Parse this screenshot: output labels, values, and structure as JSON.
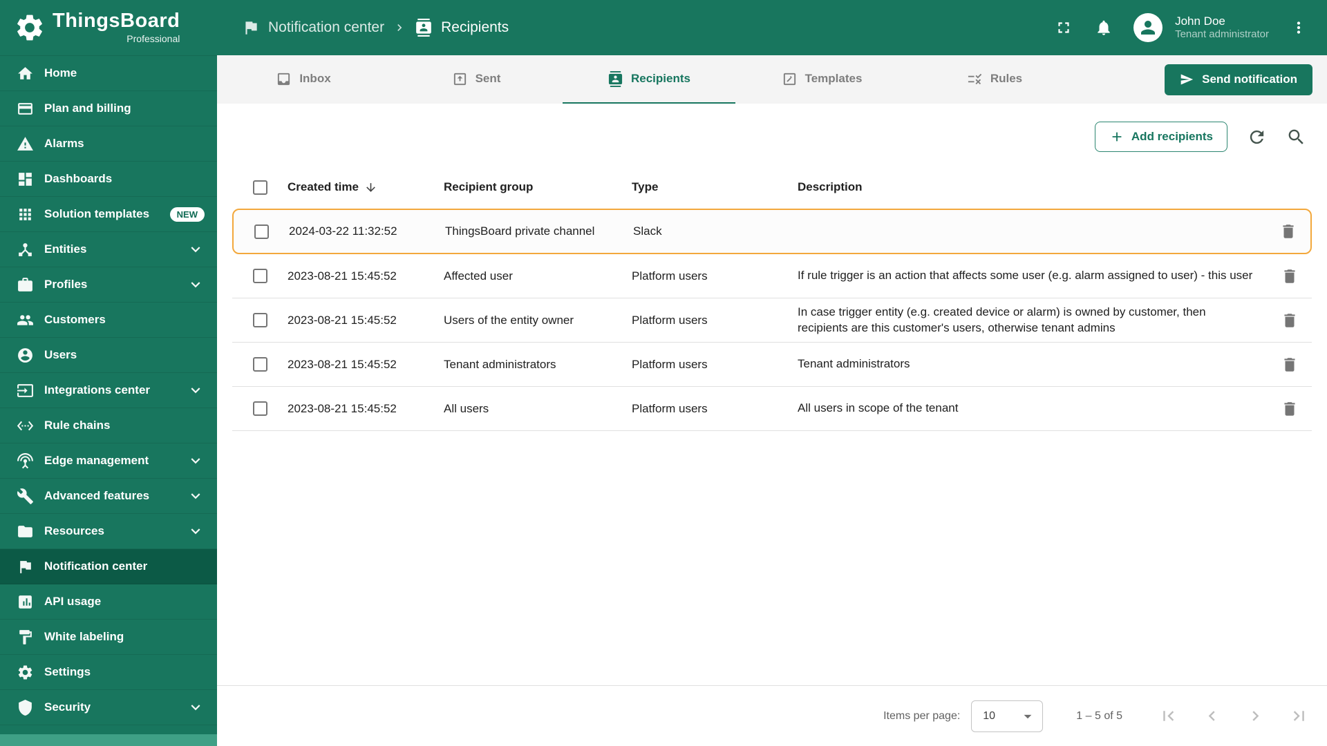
{
  "brand": {
    "name": "ThingsBoard",
    "edition": "Professional"
  },
  "breadcrumb": {
    "parent": "Notification center",
    "current": "Recipients"
  },
  "user": {
    "name": "John Doe",
    "role": "Tenant administrator"
  },
  "colors": {
    "primary": "#18765E",
    "sidebar_active": "#0C5A46",
    "highlight_border": "#F3A83C"
  },
  "sidebar": {
    "items": [
      {
        "label": "Home",
        "icon": "home"
      },
      {
        "label": "Plan and billing",
        "icon": "credit-card"
      },
      {
        "label": "Alarms",
        "icon": "warning"
      },
      {
        "label": "Dashboards",
        "icon": "dashboard"
      },
      {
        "label": "Solution templates",
        "icon": "apps",
        "badge": "NEW"
      },
      {
        "label": "Entities",
        "icon": "hub",
        "expandable": true
      },
      {
        "label": "Profiles",
        "icon": "briefcase",
        "expandable": true
      },
      {
        "label": "Customers",
        "icon": "people"
      },
      {
        "label": "Users",
        "icon": "account"
      },
      {
        "label": "Integrations center",
        "icon": "input",
        "expandable": true
      },
      {
        "label": "Rule chains",
        "icon": "ethernet"
      },
      {
        "label": "Edge management",
        "icon": "antenna",
        "expandable": true
      },
      {
        "label": "Advanced features",
        "icon": "build",
        "expandable": true
      },
      {
        "label": "Resources",
        "icon": "folder",
        "expandable": true
      },
      {
        "label": "Notification center",
        "icon": "flag",
        "active": true
      },
      {
        "label": "API usage",
        "icon": "chart"
      },
      {
        "label": "White labeling",
        "icon": "paint"
      },
      {
        "label": "Settings",
        "icon": "gear"
      },
      {
        "label": "Security",
        "icon": "shield",
        "expandable": true
      }
    ]
  },
  "tabs": [
    {
      "label": "Inbox",
      "icon": "inbox"
    },
    {
      "label": "Sent",
      "icon": "outbox"
    },
    {
      "label": "Recipients",
      "icon": "contacts",
      "active": true
    },
    {
      "label": "Templates",
      "icon": "template"
    },
    {
      "label": "Rules",
      "icon": "rule"
    }
  ],
  "actions": {
    "send_notification": "Send notification",
    "add_recipients": "Add recipients"
  },
  "table": {
    "columns": [
      "Created time",
      "Recipient group",
      "Type",
      "Description"
    ],
    "rows": [
      {
        "created": "2024-03-22 11:32:52",
        "group": "ThingsBoard private channel",
        "type": "Slack",
        "description": "",
        "highlighted": true
      },
      {
        "created": "2023-08-21 15:45:52",
        "group": "Affected user",
        "type": "Platform users",
        "description": "If rule trigger is an action that affects some user (e.g. alarm assigned to user) - this user"
      },
      {
        "created": "2023-08-21 15:45:52",
        "group": "Users of the entity owner",
        "type": "Platform users",
        "description": "In case trigger entity (e.g. created device or alarm) is owned by customer, then recipients are this customer's users, otherwise tenant admins"
      },
      {
        "created": "2023-08-21 15:45:52",
        "group": "Tenant administrators",
        "type": "Platform users",
        "description": "Tenant administrators"
      },
      {
        "created": "2023-08-21 15:45:52",
        "group": "All users",
        "type": "Platform users",
        "description": "All users in scope of the tenant"
      }
    ]
  },
  "pagination": {
    "items_per_page_label": "Items per page:",
    "items_per_page_value": "10",
    "range": "1 – 5 of 5"
  },
  "chrome_icons": [
    "thingsboard-logo",
    "fullscreen",
    "notifications-bell",
    "avatar-person",
    "more-vert",
    "breadcrumb-flag",
    "breadcrumb-contacts",
    "send-plane",
    "plus",
    "refresh",
    "search",
    "sort-descending",
    "trash",
    "dropdown-arrow",
    "first-page",
    "previous-page",
    "next-page",
    "last-page",
    "chevron-down"
  ]
}
